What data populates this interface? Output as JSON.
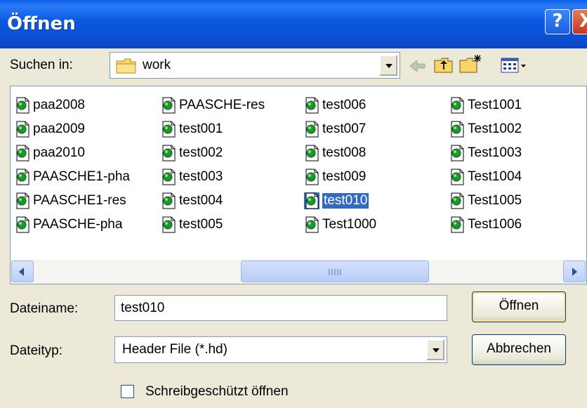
{
  "window": {
    "title": "Öffnen",
    "help_label": "?",
    "close_label": "X"
  },
  "location": {
    "label": "Suchen in:",
    "value": "work"
  },
  "files": [
    {
      "name": "paa2008",
      "selected": false
    },
    {
      "name": "paa2009",
      "selected": false
    },
    {
      "name": "paa2010",
      "selected": false
    },
    {
      "name": "PAASCHE1-pha",
      "selected": false
    },
    {
      "name": "PAASCHE1-res",
      "selected": false
    },
    {
      "name": "PAASCHE-pha",
      "selected": false
    },
    {
      "name": "PAASCHE-res",
      "selected": false
    },
    {
      "name": "test001",
      "selected": false
    },
    {
      "name": "test002",
      "selected": false
    },
    {
      "name": "test003",
      "selected": false
    },
    {
      "name": "test004",
      "selected": false
    },
    {
      "name": "test005",
      "selected": false
    },
    {
      "name": "test006",
      "selected": false
    },
    {
      "name": "test007",
      "selected": false
    },
    {
      "name": "test008",
      "selected": false
    },
    {
      "name": "test009",
      "selected": false
    },
    {
      "name": "test010",
      "selected": true
    },
    {
      "name": "Test1000",
      "selected": false
    },
    {
      "name": "Test1001",
      "selected": false
    },
    {
      "name": "Test1002",
      "selected": false
    },
    {
      "name": "Test1003",
      "selected": false
    },
    {
      "name": "Test1004",
      "selected": false
    },
    {
      "name": "Test1005",
      "selected": false
    },
    {
      "name": "Test1006",
      "selected": false
    }
  ],
  "filename": {
    "label": "Dateiname:",
    "value": "test010"
  },
  "filetype": {
    "label": "Dateityp:",
    "value": "Header File (*.hd)"
  },
  "buttons": {
    "open": "Öffnen",
    "cancel": "Abbrechen"
  },
  "readonly": {
    "label": "Schreibgeschützt öffnen",
    "checked": false
  },
  "colors": {
    "titlebar": "#0a57df",
    "selection": "#316ac5",
    "dialog_bg": "#ece9d8"
  }
}
